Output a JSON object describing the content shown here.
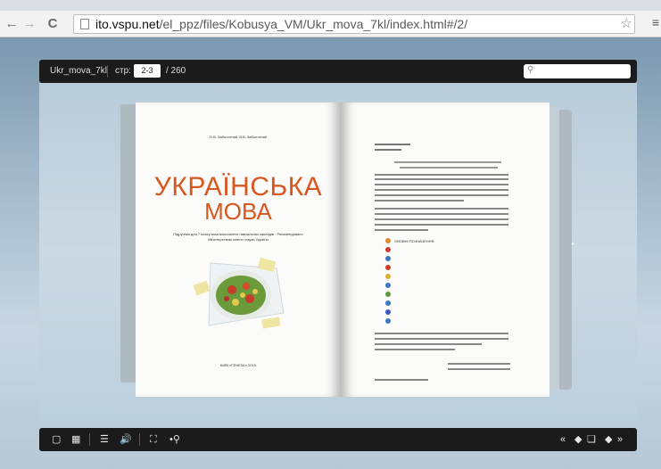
{
  "browser": {
    "back": "←",
    "forward": "→",
    "reload": "C",
    "url_host": "ito.vspu.net",
    "url_path": "/el_ppz/files/Kobusya_VM/Ukr_mova_7kl/index.html#/2/",
    "star": "☆",
    "menu": "≡"
  },
  "toolbar": {
    "book_title": "Ukr_mova_7kl",
    "page_label": "стр:",
    "page_value": "2-3",
    "page_total": "/ 260",
    "search_icon": "search-icon"
  },
  "book": {
    "left_page": {
      "authors": "О.В. Заболотний, В.В. Заболотний",
      "title_line1": "УКРАЇНСЬКА",
      "title_line2": "МОВА",
      "subtitle": "Підручник для 7 класу загальноосвітніх навчальних закладів · Рекомендовано Міністерством освіти і науки України",
      "publisher": "КИЇВ «ГЕНЕЗА» 2015"
    },
    "right_page": {
      "legend_heading": "УМОВНІ ПОЗНАЧЕННЯ:"
    }
  },
  "bottom_toolbar": {
    "icons": [
      "single-page-icon",
      "thumbnails-icon",
      "table-of-contents-icon",
      "sound-icon",
      "fullscreen-icon",
      "zoom-icon",
      "first-page-icon",
      "previous-page-icon",
      "pages-icon",
      "next-page-icon",
      "last-page-icon"
    ]
  },
  "colors": {
    "title_orange": "#d8571e",
    "toolbar_bg": "#1b1b1b"
  }
}
